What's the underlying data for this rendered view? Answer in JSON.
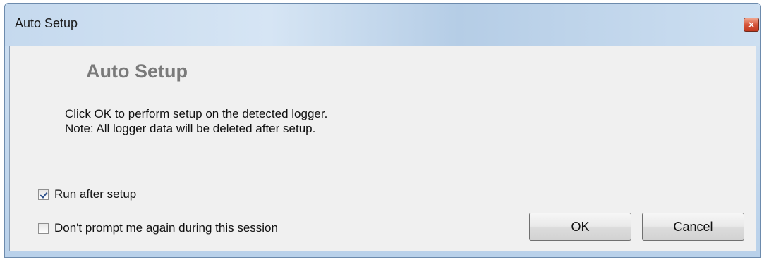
{
  "window": {
    "title": "Auto Setup",
    "close_glyph": "×"
  },
  "dialog": {
    "heading": "Auto Setup",
    "message_line1": "Click OK to perform setup on the detected logger.",
    "message_line2": "Note: All logger data will be deleted after setup."
  },
  "options": [
    {
      "label": "Run after setup",
      "checked": true
    },
    {
      "label": "Don't prompt me again during this session",
      "checked": false
    }
  ],
  "buttons": {
    "ok_label": "OK",
    "cancel_label": "Cancel"
  },
  "icons": {
    "close": "close-icon",
    "check": "checkmark-icon"
  },
  "colors": {
    "heading": "#7a7a7a",
    "close_button": "#c2391f",
    "check_mark": "#2c4f8a"
  }
}
